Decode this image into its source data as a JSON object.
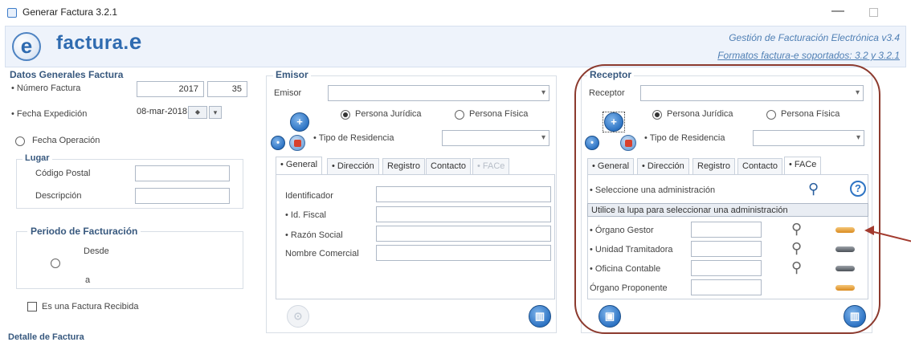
{
  "window": {
    "title": "Generar Factura 3.2.1"
  },
  "header": {
    "logo_text": "factura.",
    "logo_e": "e",
    "app_line": "Gestión de Facturación Electrónica v3.4",
    "formats_line": "Formatos factura-e soportados: 3.2 y 3.2.1"
  },
  "datos": {
    "title": "Datos Generales Factura",
    "numero_label": "• Número Factura",
    "numero_year": "2017",
    "numero_seq": "35",
    "fecha_exp_label": "• Fecha Expedición",
    "fecha_exp_value": "08-mar-2018",
    "fecha_op_label": "Fecha Operación",
    "lugar_title": "Lugar",
    "cp_label": "Código Postal",
    "desc_label": "Descripción",
    "periodo_title": "Periodo de Facturación",
    "desde_label": "Desde",
    "a_label": "a",
    "recibida_label": "Es una Factura Recibida",
    "detalle_title": "Detalle de Factura"
  },
  "emisor": {
    "title": "Emisor",
    "combo_label": "Emisor",
    "persona_juridica": "Persona Jurídica",
    "persona_fisica": "Persona Física",
    "tipo_residencia_label": "• Tipo de Residencia",
    "tabs": [
      "• General",
      "• Dirección",
      "Registro",
      "Contacto",
      "• FACe"
    ],
    "identificador_label": "Identificador",
    "id_fiscal_label": "• Id. Fiscal",
    "razon_social_label": "• Razón Social",
    "nombre_comercial_label": "Nombre Comercial"
  },
  "receptor": {
    "title": "Receptor",
    "combo_label": "Receptor",
    "persona_juridica": "Persona Jurídica",
    "persona_fisica": "Persona Física",
    "tipo_residencia_label": "• Tipo de Residencia",
    "tabs": [
      "• General",
      "• Dirección",
      "Registro",
      "Contacto",
      "• FACe"
    ],
    "seleccione_label": "• Seleccione una administración",
    "hint": "Utilice la lupa para seleccionar una administración",
    "organo_gestor_label": "• Órgano Gestor",
    "unidad_tramitadora_label": "• Unidad Tramitadora",
    "oficina_contable_label": "• Oficina Contable",
    "organo_proponente_label": "Órgano Proponente"
  },
  "icons": {
    "magnify": "magnifier-icon",
    "help": "help-icon",
    "pencil": "pencil-icon",
    "bank": "bank-icon",
    "person": "person-icon"
  },
  "colors": {
    "accent": "#2f6bb0",
    "annotation": "#8c3a2e"
  }
}
